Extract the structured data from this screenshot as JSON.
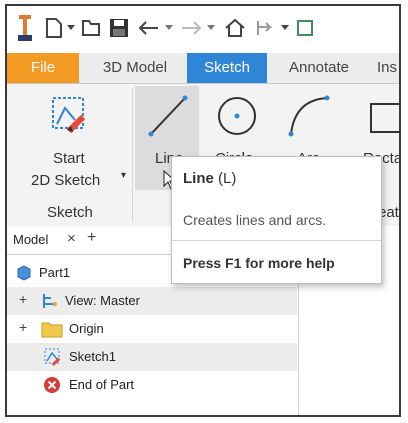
{
  "quick_access": {
    "icons": [
      "app-menu-icon",
      "new-icon",
      "dropdown-arrow-icon",
      "open-icon",
      "save-icon",
      "undo-icon",
      "dropdown-arrow-icon",
      "redo-icon",
      "dropdown-arrow-icon",
      "home-icon",
      "return-icon",
      "dropdown-arrow-icon",
      "update-icon"
    ]
  },
  "tabs": {
    "file": "File",
    "model3d": "3D Model",
    "sketch": "Sketch",
    "annotate": "Annotate",
    "inspect": "Ins"
  },
  "colors": {
    "file_tab": "#f39a24",
    "active_tab": "#2f86d6",
    "accent_blue": "#2f86d6",
    "sketch_red": "#e64a3c"
  },
  "ribbon": {
    "start_sketch_line1": "Start",
    "start_sketch_line2": "2D Sketch",
    "sketch_group": "Sketch",
    "line": "Line",
    "circle": "Circle",
    "arc": "Arc",
    "rectangle": "Rectan",
    "create_group": "reat"
  },
  "browser": {
    "tab_label": "Model",
    "close_glyph": "×",
    "add_glyph": "+",
    "tree": [
      {
        "label": "Part1",
        "icon": "part-icon",
        "expander": ""
      },
      {
        "label": "View: Master",
        "icon": "view-icon",
        "expander": "+"
      },
      {
        "label": "Origin",
        "icon": "folder-icon",
        "expander": "+"
      },
      {
        "label": "Sketch1",
        "icon": "sketch-icon",
        "expander": ""
      },
      {
        "label": "End of Part",
        "icon": "end-of-part-icon",
        "expander": ""
      }
    ]
  },
  "tooltip": {
    "title": "Line",
    "shortcut": " (L)",
    "description": "Creates lines and arcs.",
    "help": "Press F1 for more help"
  }
}
